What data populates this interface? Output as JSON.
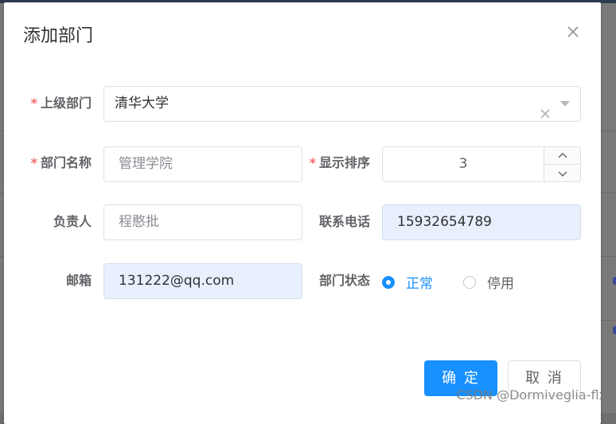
{
  "dialog": {
    "title": "添加部门"
  },
  "form": {
    "parent_dept": {
      "label": "上级部门",
      "required": "*",
      "value": "清华大学"
    },
    "dept_name": {
      "label": "部门名称",
      "required": "*",
      "value": "管理学院"
    },
    "sort_order": {
      "label": "显示排序",
      "required": "*",
      "value": "3"
    },
    "leader": {
      "label": "负责人",
      "value": "程憨批"
    },
    "phone": {
      "label": "联系电话",
      "value": "15932654789"
    },
    "email": {
      "label": "邮箱",
      "value": "131222@qq.com"
    },
    "status": {
      "label": "部门状态",
      "options": [
        "正常",
        "停用"
      ],
      "selected": "正常"
    }
  },
  "footer": {
    "confirm_label": "确 定",
    "cancel_label": "取 消"
  },
  "watermark": "CSDN @Dormiveglia-flx",
  "colors": {
    "primary": "#1890ff",
    "required": "#f56c6c",
    "autofill_bg": "#e8f0fe"
  },
  "icons": {
    "close": "close-icon",
    "clear": "circle-close-icon",
    "dropdown": "arrow-down-icon",
    "increase": "chevron-up-icon",
    "decrease": "chevron-down-icon"
  }
}
